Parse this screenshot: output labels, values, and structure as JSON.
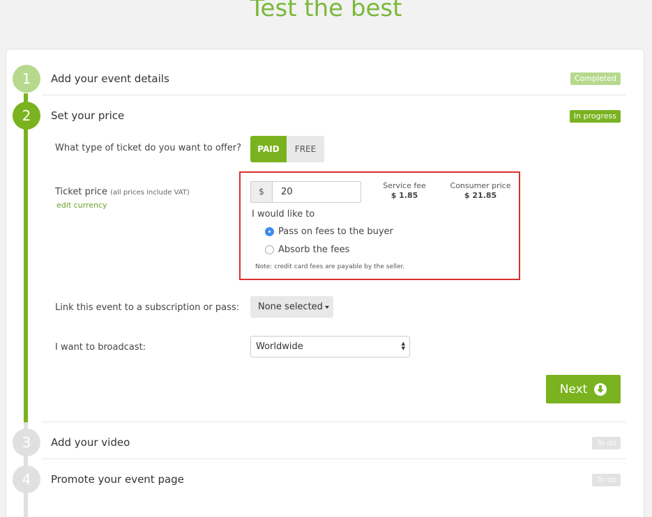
{
  "page": {
    "title": "Test the best"
  },
  "steps": [
    {
      "number": "1",
      "title": "Add your event details",
      "status": "Completed"
    },
    {
      "number": "2",
      "title": "Set your price",
      "status": "In progress"
    },
    {
      "number": "3",
      "title": "Add your video",
      "status": "To do"
    },
    {
      "number": "4",
      "title": "Promote your event page",
      "status": "To do"
    }
  ],
  "price_form": {
    "ticket_type_label": "What type of ticket do you want to offer?",
    "paid_label": "PAID",
    "free_label": "FREE",
    "selected_type": "PAID",
    "ticket_price_label": "Ticket price",
    "ticket_price_note": "(all prices include VAT)",
    "edit_currency": "edit currency",
    "currency_symbol": "$",
    "price_value": "20",
    "service_fee_label": "Service fee",
    "service_fee_value": "$ 1.85",
    "consumer_price_label": "Consumer price",
    "consumer_price_value": "$ 21.85",
    "would_like_label": "I would like to",
    "fee_options": [
      {
        "label": "Pass on fees to the buyer",
        "selected": true
      },
      {
        "label": "Absorb the fees",
        "selected": false
      }
    ],
    "note": "Note: credit card fees are payable by the seller.",
    "subscription_label": "Link this event to a subscription or pass:",
    "subscription_value": "None selected",
    "broadcast_label": "I want to broadcast:",
    "broadcast_value": "Worldwide",
    "next_label": "Next"
  },
  "colors": {
    "accent": "#7ab31f",
    "highlight_border": "#d9302c",
    "title": "#7ab83a",
    "radio": "#3b8ee8"
  }
}
